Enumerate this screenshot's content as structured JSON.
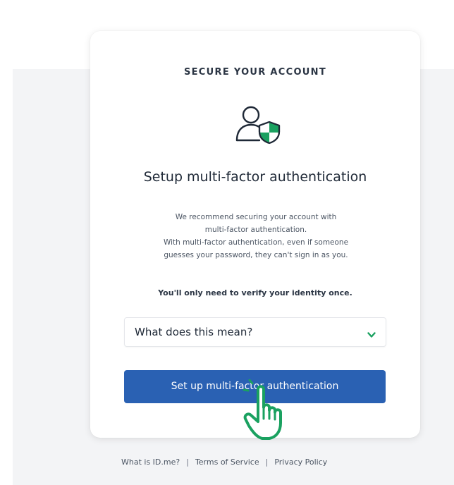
{
  "card": {
    "eyebrow": "SECURE YOUR ACCOUNT",
    "icon": "user-shield-icon",
    "title": "Setup multi-factor authentication",
    "description_lines": [
      "We recommend securing your account with",
      "multi-factor authentication.",
      "With multi-factor authentication, even if someone",
      "guesses your password, they can't sign in as you."
    ],
    "emphasis": "You'll only need to verify your identity once.",
    "accordion": {
      "label": "What does this mean?",
      "icon": "chevron-down-icon",
      "expanded": false
    },
    "cta_label": "Set up multi-factor authentication",
    "pointer_icon": "hand-pointer-icon"
  },
  "footer": {
    "links": [
      "What is ID.me?",
      "Terms of Service",
      "Privacy Policy"
    ],
    "separator": "|"
  },
  "colors": {
    "primary": "#2a61b3",
    "accent_green": "#1aa160",
    "text_dark": "#1f2937",
    "background": "#f3f4f6"
  }
}
